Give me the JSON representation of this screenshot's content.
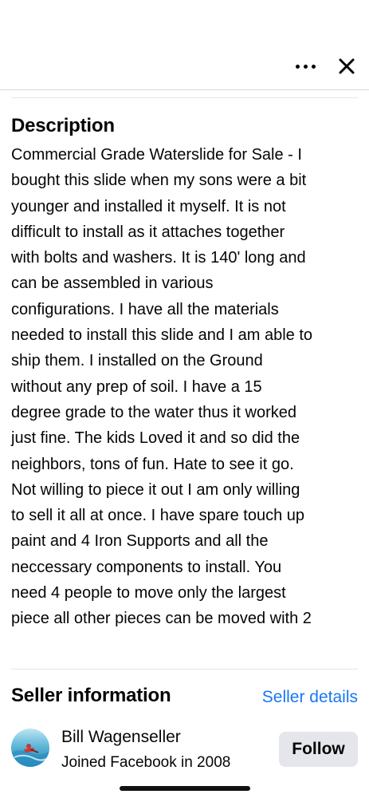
{
  "header": {
    "more_icon": "more-horizontal-icon",
    "close_icon": "close-icon"
  },
  "description": {
    "heading": "Description",
    "lines": [
      "Commercial Grade Waterslide for Sale - I",
      "bought this slide when my sons were a bit",
      "younger and installed it myself.  It is not",
      "difficult to install as it attaches together",
      "with bolts and washers.  It is 140' long and",
      "can be assembled in various",
      "configurations.  I have all the materials",
      "needed to install this slide and I am able to",
      "ship them.  I installed on the Ground",
      "without any prep of soil.  I have a 15",
      "degree grade to the water thus it worked",
      "just fine.  The kids Loved it and so did the",
      "neighbors, tons of fun.  Hate to see it go.",
      "Not willing to piece it out I am only willing",
      "to sell it all at once.  I have spare touch up",
      "paint and 4 Iron Supports and all the",
      "neccessary components to install.  You",
      "need 4 people to move only the largest",
      "piece all other pieces can be moved with 2"
    ]
  },
  "seller": {
    "heading": "Seller information",
    "details_link": "Seller details",
    "name": "Bill Wagenseller",
    "joined": "Joined Facebook in 2008",
    "follow_label": "Follow"
  },
  "colors": {
    "link": "#1877f2",
    "button_bg": "#e4e6eb",
    "text": "#050505"
  }
}
